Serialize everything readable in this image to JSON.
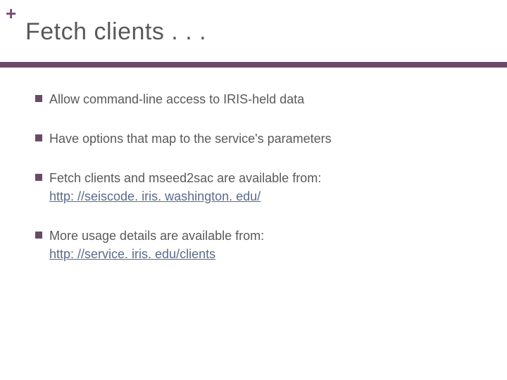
{
  "header": {
    "plus_glyph": "+",
    "title": "Fetch clients . . ."
  },
  "bullets": [
    {
      "text": "Allow command-line access to IRIS-held data",
      "link": null
    },
    {
      "text": "Have options that map to the service's parameters",
      "link": null
    },
    {
      "text": "Fetch clients and mseed2sac are available from:",
      "link": "http: //seiscode. iris. washington. edu/"
    },
    {
      "text": "More usage details are available from:",
      "link": "http: //service. iris. edu/clients"
    }
  ]
}
